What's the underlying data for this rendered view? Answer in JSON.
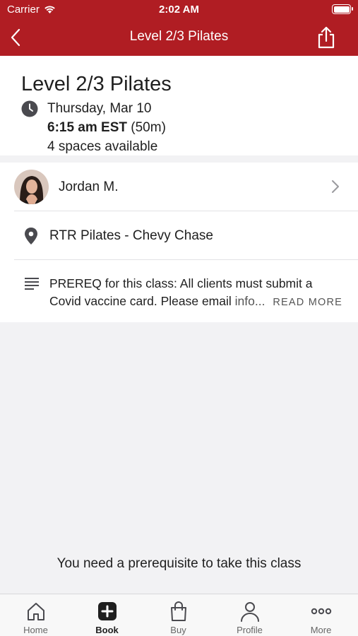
{
  "status_bar": {
    "carrier": "Carrier",
    "time": "2:02 AM"
  },
  "nav": {
    "title": "Level 2/3 Pilates",
    "back_icon": "chevron-left-icon",
    "share_icon": "share-icon"
  },
  "class": {
    "title": "Level 2/3 Pilates",
    "date": "Thursday, Mar 10",
    "start_time": "6:15 am EST",
    "duration": "(50m)",
    "spaces": "4 spaces available"
  },
  "instructor": {
    "name": "Jordan M."
  },
  "location": {
    "name": "RTR Pilates - Chevy Chase"
  },
  "description": {
    "line1": "PREREQ for this class: All clients must submit a",
    "line2_text": "Covid vaccine card. Please email ",
    "line2_link": "info...",
    "read_more": "READ MORE"
  },
  "footer_message": "You need a prerequisite to take this class",
  "tabs": [
    {
      "label": "Home",
      "icon": "home-icon"
    },
    {
      "label": "Book",
      "icon": "book-plus-icon"
    },
    {
      "label": "Buy",
      "icon": "shopping-bag-icon"
    },
    {
      "label": "Profile",
      "icon": "profile-icon"
    },
    {
      "label": "More",
      "icon": "more-dots-icon"
    }
  ],
  "colors": {
    "brand": "#b01d23",
    "background": "#f2f2f4"
  }
}
